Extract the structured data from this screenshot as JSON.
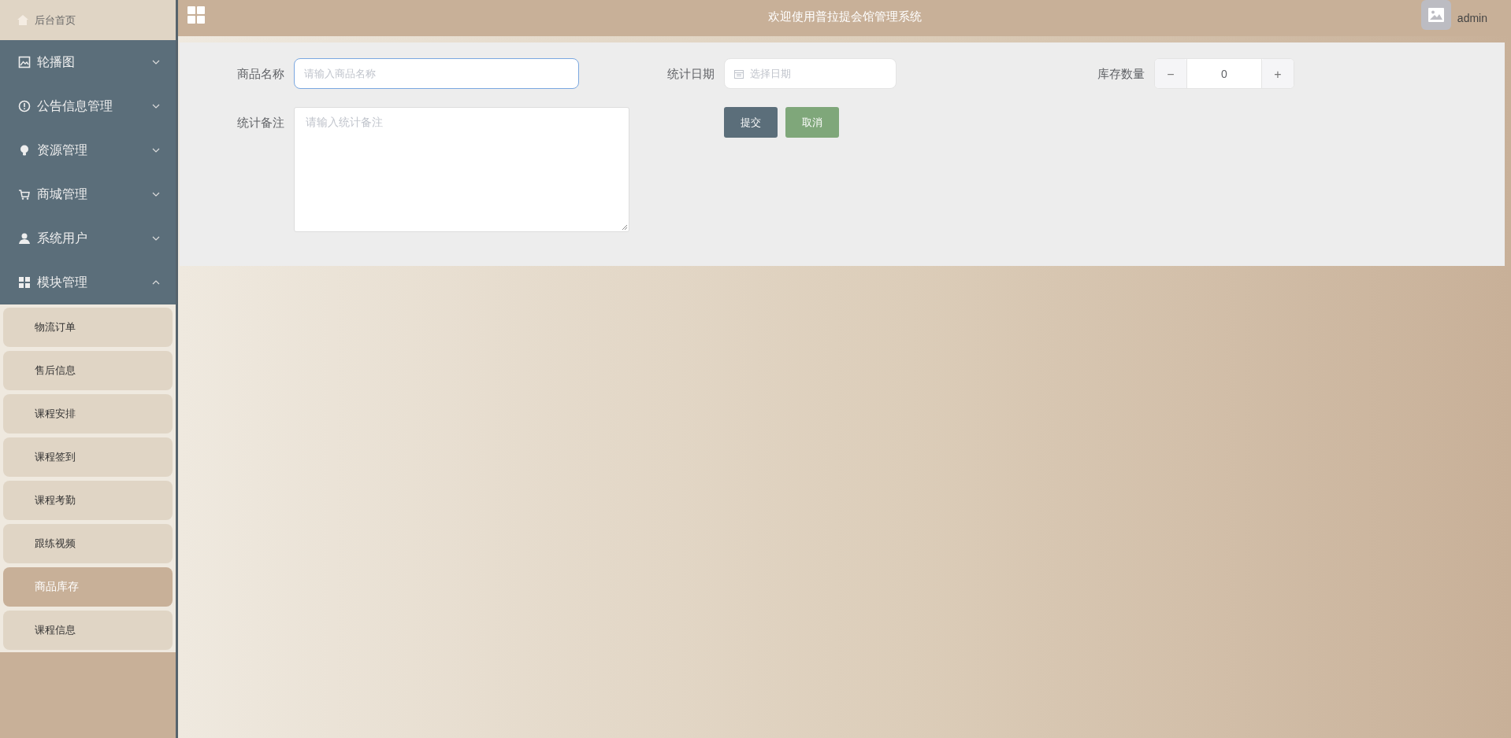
{
  "sidebar": {
    "home": {
      "label": "后台首页"
    },
    "menus": [
      {
        "label": "轮播图",
        "expanded": false
      },
      {
        "label": "公告信息管理",
        "expanded": false
      },
      {
        "label": "资源管理",
        "expanded": false
      },
      {
        "label": "商城管理",
        "expanded": false
      },
      {
        "label": "系统用户",
        "expanded": false
      },
      {
        "label": "模块管理",
        "expanded": true,
        "children": [
          {
            "label": "物流订单",
            "selected": false
          },
          {
            "label": "售后信息",
            "selected": false
          },
          {
            "label": "课程安排",
            "selected": false
          },
          {
            "label": "课程签到",
            "selected": false
          },
          {
            "label": "课程考勤",
            "selected": false
          },
          {
            "label": "跟练视频",
            "selected": false
          },
          {
            "label": "商品库存",
            "selected": true
          },
          {
            "label": "课程信息",
            "selected": false
          }
        ]
      }
    ]
  },
  "header": {
    "title": "欢迎使用普拉提会馆管理系统",
    "user": "admin"
  },
  "form": {
    "fields": [
      {
        "kind": "text",
        "label": "商品名称",
        "placeholder": "请输入商品名称",
        "focused": true
      },
      {
        "kind": "date",
        "label": "统计日期",
        "placeholder": "选择日期",
        "focused": false
      },
      {
        "kind": "number",
        "label": "库存数量",
        "value": "0",
        "minus": "−",
        "plus": "+",
        "focused": false
      },
      {
        "kind": "textarea",
        "label": "统计备注",
        "placeholder": "请输入统计备注",
        "focused": false
      }
    ],
    "buttons": [
      {
        "kind": "primary",
        "label": "提交"
      },
      {
        "kind": "cancel",
        "label": "取消"
      }
    ]
  }
}
